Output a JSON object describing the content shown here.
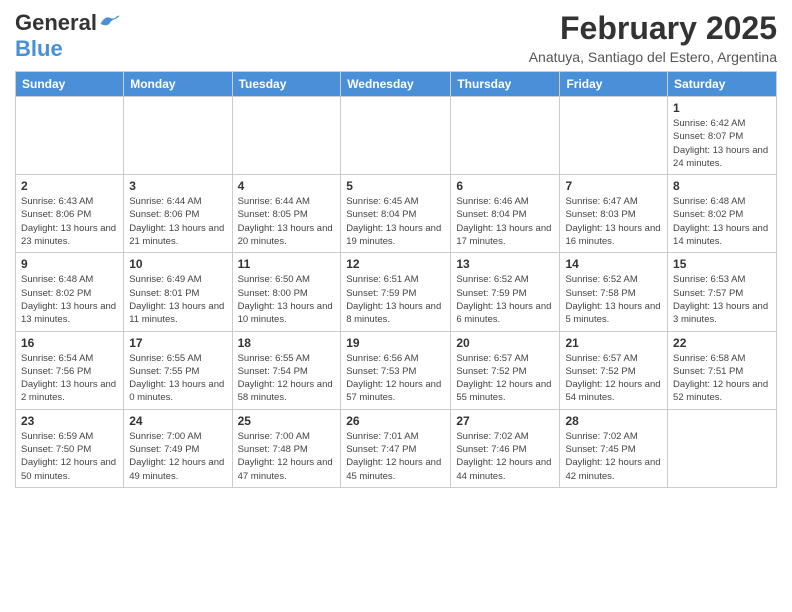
{
  "header": {
    "logo_general": "General",
    "logo_blue": "Blue",
    "month": "February 2025",
    "location": "Anatuya, Santiago del Estero, Argentina"
  },
  "weekdays": [
    "Sunday",
    "Monday",
    "Tuesday",
    "Wednesday",
    "Thursday",
    "Friday",
    "Saturday"
  ],
  "weeks": [
    [
      {
        "day": "",
        "info": ""
      },
      {
        "day": "",
        "info": ""
      },
      {
        "day": "",
        "info": ""
      },
      {
        "day": "",
        "info": ""
      },
      {
        "day": "",
        "info": ""
      },
      {
        "day": "",
        "info": ""
      },
      {
        "day": "1",
        "info": "Sunrise: 6:42 AM\nSunset: 8:07 PM\nDaylight: 13 hours and 24 minutes."
      }
    ],
    [
      {
        "day": "2",
        "info": "Sunrise: 6:43 AM\nSunset: 8:06 PM\nDaylight: 13 hours and 23 minutes."
      },
      {
        "day": "3",
        "info": "Sunrise: 6:44 AM\nSunset: 8:06 PM\nDaylight: 13 hours and 21 minutes."
      },
      {
        "day": "4",
        "info": "Sunrise: 6:44 AM\nSunset: 8:05 PM\nDaylight: 13 hours and 20 minutes."
      },
      {
        "day": "5",
        "info": "Sunrise: 6:45 AM\nSunset: 8:04 PM\nDaylight: 13 hours and 19 minutes."
      },
      {
        "day": "6",
        "info": "Sunrise: 6:46 AM\nSunset: 8:04 PM\nDaylight: 13 hours and 17 minutes."
      },
      {
        "day": "7",
        "info": "Sunrise: 6:47 AM\nSunset: 8:03 PM\nDaylight: 13 hours and 16 minutes."
      },
      {
        "day": "8",
        "info": "Sunrise: 6:48 AM\nSunset: 8:02 PM\nDaylight: 13 hours and 14 minutes."
      }
    ],
    [
      {
        "day": "9",
        "info": "Sunrise: 6:48 AM\nSunset: 8:02 PM\nDaylight: 13 hours and 13 minutes."
      },
      {
        "day": "10",
        "info": "Sunrise: 6:49 AM\nSunset: 8:01 PM\nDaylight: 13 hours and 11 minutes."
      },
      {
        "day": "11",
        "info": "Sunrise: 6:50 AM\nSunset: 8:00 PM\nDaylight: 13 hours and 10 minutes."
      },
      {
        "day": "12",
        "info": "Sunrise: 6:51 AM\nSunset: 7:59 PM\nDaylight: 13 hours and 8 minutes."
      },
      {
        "day": "13",
        "info": "Sunrise: 6:52 AM\nSunset: 7:59 PM\nDaylight: 13 hours and 6 minutes."
      },
      {
        "day": "14",
        "info": "Sunrise: 6:52 AM\nSunset: 7:58 PM\nDaylight: 13 hours and 5 minutes."
      },
      {
        "day": "15",
        "info": "Sunrise: 6:53 AM\nSunset: 7:57 PM\nDaylight: 13 hours and 3 minutes."
      }
    ],
    [
      {
        "day": "16",
        "info": "Sunrise: 6:54 AM\nSunset: 7:56 PM\nDaylight: 13 hours and 2 minutes."
      },
      {
        "day": "17",
        "info": "Sunrise: 6:55 AM\nSunset: 7:55 PM\nDaylight: 13 hours and 0 minutes."
      },
      {
        "day": "18",
        "info": "Sunrise: 6:55 AM\nSunset: 7:54 PM\nDaylight: 12 hours and 58 minutes."
      },
      {
        "day": "19",
        "info": "Sunrise: 6:56 AM\nSunset: 7:53 PM\nDaylight: 12 hours and 57 minutes."
      },
      {
        "day": "20",
        "info": "Sunrise: 6:57 AM\nSunset: 7:52 PM\nDaylight: 12 hours and 55 minutes."
      },
      {
        "day": "21",
        "info": "Sunrise: 6:57 AM\nSunset: 7:52 PM\nDaylight: 12 hours and 54 minutes."
      },
      {
        "day": "22",
        "info": "Sunrise: 6:58 AM\nSunset: 7:51 PM\nDaylight: 12 hours and 52 minutes."
      }
    ],
    [
      {
        "day": "23",
        "info": "Sunrise: 6:59 AM\nSunset: 7:50 PM\nDaylight: 12 hours and 50 minutes."
      },
      {
        "day": "24",
        "info": "Sunrise: 7:00 AM\nSunset: 7:49 PM\nDaylight: 12 hours and 49 minutes."
      },
      {
        "day": "25",
        "info": "Sunrise: 7:00 AM\nSunset: 7:48 PM\nDaylight: 12 hours and 47 minutes."
      },
      {
        "day": "26",
        "info": "Sunrise: 7:01 AM\nSunset: 7:47 PM\nDaylight: 12 hours and 45 minutes."
      },
      {
        "day": "27",
        "info": "Sunrise: 7:02 AM\nSunset: 7:46 PM\nDaylight: 12 hours and 44 minutes."
      },
      {
        "day": "28",
        "info": "Sunrise: 7:02 AM\nSunset: 7:45 PM\nDaylight: 12 hours and 42 minutes."
      },
      {
        "day": "",
        "info": ""
      }
    ]
  ]
}
